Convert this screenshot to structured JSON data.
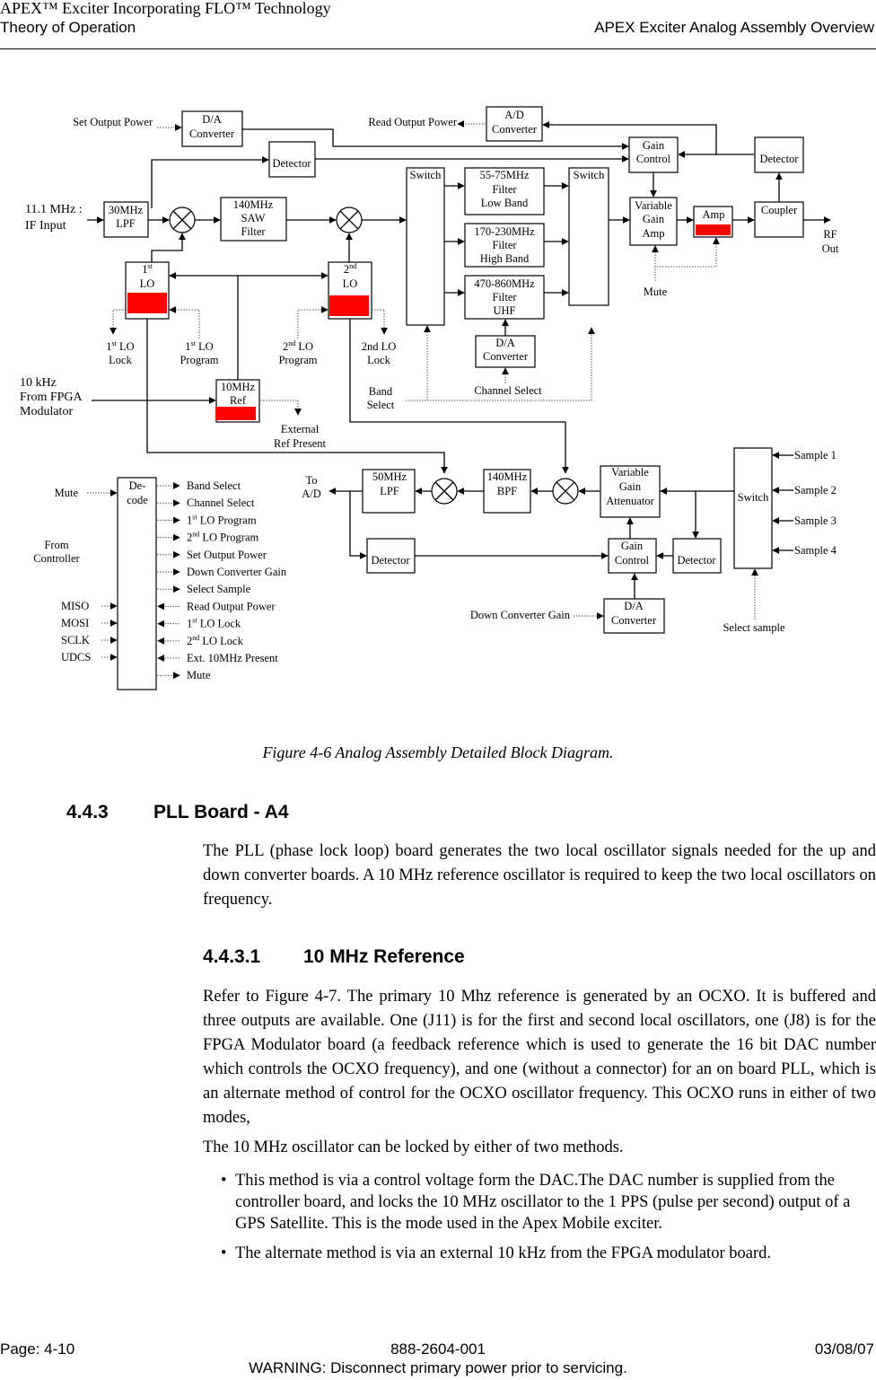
{
  "header": {
    "title_line1": "APEX™ Exciter Incorporating FLO™ Technology",
    "title_line2": "Theory of Operation",
    "section": "APEX Exciter Analog Assembly Overview"
  },
  "diagram": {
    "upconverter": {
      "set_output_power": "Set Output Power",
      "da_top_1": "D/A",
      "da_top_2": "Converter",
      "read_output_power": "Read Output Power",
      "ad_1": "A/D",
      "ad_2": "Converter",
      "detector_top": "Detector",
      "gain_control_1": "Gain",
      "gain_control_2": "Control",
      "detector_right": "Detector",
      "if_input_1": "11.1 MHz  :",
      "if_input_2": "IF Input",
      "lpf30_1": "30MHz",
      "lpf30_2": "LPF",
      "saw_1": "140MHz",
      "saw_2": "SAW",
      "saw_3": "Filter",
      "switch_a": "Switch",
      "switch_b": "Switch",
      "filter_low_1": "55-75MHz",
      "filter_low_2": "Filter",
      "filter_low_3": "Low Band",
      "filter_high_1": "170-230MHz",
      "filter_high_2": "Filter",
      "filter_high_3": "High Band",
      "filter_uhf_1": "470-860MHz",
      "filter_uhf_2": "Filter",
      "filter_uhf_3": "UHF",
      "vga_1": "Variable",
      "vga_2": "Gain",
      "vga_3": "Amp",
      "amp": "Amp",
      "coupler": "Coupler",
      "rf_out_1": "RF",
      "rf_out_2": "Out",
      "mute": "Mute",
      "lo1_sup": "st",
      "lo1_num": "1",
      "lo1_label": "LO",
      "lo2_sup": "nd",
      "lo2_num": "2",
      "lo2_label": "LO",
      "lo1_lock_sup": "st",
      "lo1_lock_1": " LO",
      "lo1_lock_2": "Lock",
      "lo1_prog_1": " LO",
      "lo1_prog_2": "Program",
      "lo2_prog_sup": "nd",
      "lo2_prog_1": " LO",
      "lo2_prog_2": "Program",
      "lo2_lock_1": "2nd LO",
      "lo2_lock_2": "Lock",
      "da_mid_1": "D/A",
      "da_mid_2": "Converter",
      "ref10k_1": "10 kHz",
      "ref10k_2": "From FPGA",
      "ref10k_3": "Modulator",
      "ref10m_1": "10MHz",
      "ref10m_2": "Ref",
      "band_select_1": "Band",
      "band_select_2": "Select",
      "channel_select": "Channel Select",
      "ext_ref_1": "External",
      "ext_ref_2": "Ref Present"
    },
    "downconverter": {
      "to_ad_1": "To",
      "to_ad_2": "A/D",
      "lpf50_1": "50MHz",
      "lpf50_2": "LPF",
      "bpf_1": "140MHz",
      "bpf_2": "BPF",
      "vga_1": "Variable",
      "vga_2": "Gain",
      "vga_3": "Attenuator",
      "switch": "Switch",
      "samples": [
        "Sample 1",
        "Sample 2",
        "Sample 3",
        "Sample 4"
      ],
      "detector_left": "Detector",
      "gain_control_1": "Gain",
      "gain_control_2": "Control",
      "detector_right": "Detector",
      "da_1": "D/A",
      "da_2": "Converter",
      "down_conv_gain": "Down Converter Gain",
      "select_sample": "Select sample"
    },
    "decoder": {
      "label_1": "De-",
      "label_2": "code",
      "mute_in": "Mute",
      "from_controller_1": "From",
      "from_controller_2": "Controller",
      "spi_inputs": [
        "MISO",
        "MOSI",
        "SCLK",
        "UDCS"
      ],
      "outputs": [
        {
          "pre": "",
          "sup": "",
          "text": "Band Select"
        },
        {
          "pre": "",
          "sup": "",
          "text": "Channel Select"
        },
        {
          "pre": "1",
          "sup": "st",
          "text": " LO Program"
        },
        {
          "pre": "2",
          "sup": "nd",
          "text": " LO Program"
        },
        {
          "pre": "",
          "sup": "",
          "text": "Set Output Power"
        },
        {
          "pre": "",
          "sup": "",
          "text": "Down Converter Gain"
        },
        {
          "pre": "",
          "sup": "",
          "text": "Select Sample"
        },
        {
          "pre": "",
          "sup": "",
          "text": "Read Output Power"
        },
        {
          "pre": "1",
          "sup": "st",
          "text": " LO Lock"
        },
        {
          "pre": "2",
          "sup": "nd",
          "text": " LO Lock"
        },
        {
          "pre": "",
          "sup": "",
          "text": "Ext. 10MHz Present"
        },
        {
          "pre": "",
          "sup": "",
          "text": "Mute"
        }
      ]
    },
    "colors": {
      "indicator": "#ff0000"
    }
  },
  "caption": "Figure 4-6  Analog Assembly Detailed Block Diagram.",
  "section": {
    "number": "4.4.3",
    "title": "PLL Board - A4"
  },
  "para1": "The PLL (phase lock loop) board generates the two local oscillator signals needed for the up and down converter boards. A 10 MHz reference oscillator is required to keep the two local oscillators on frequency.",
  "subsection": {
    "number": "4.4.3.1",
    "title": "10 MHz Reference"
  },
  "para2": "Refer to Figure 4-7. The primary 10 Mhz reference is generated by an OCXO. It is buffered and three outputs are available. One (J11) is for the first and second local oscillators, one (J8) is for the FPGA Modulator board (a feedback reference which is used to generate the 16 bit DAC number which controls the OCXO frequency), and one (without a connector) for an on board PLL, which is an alternate method of control for the OCXO oscillator frequency. This OCXO runs in either of two modes,",
  "para3": "The 10 MHz oscillator can be locked by either of two methods.",
  "bullets": [
    "This method is via a control voltage form the DAC.The DAC number is supplied from the controller board, and locks the 10 MHz oscillator to the 1 PPS (pulse per second) output of a GPS Satellite. This is the mode used in the Apex Mobile exciter.",
    "The alternate method is via an external 10 kHz from the FPGA modulator board."
  ],
  "bullet_glyph": "•",
  "footer": {
    "page": "Page: 4-10",
    "doc_number": "888-2604-001",
    "date": "03/08/07",
    "warning": "WARNING: Disconnect primary power prior to servicing."
  }
}
